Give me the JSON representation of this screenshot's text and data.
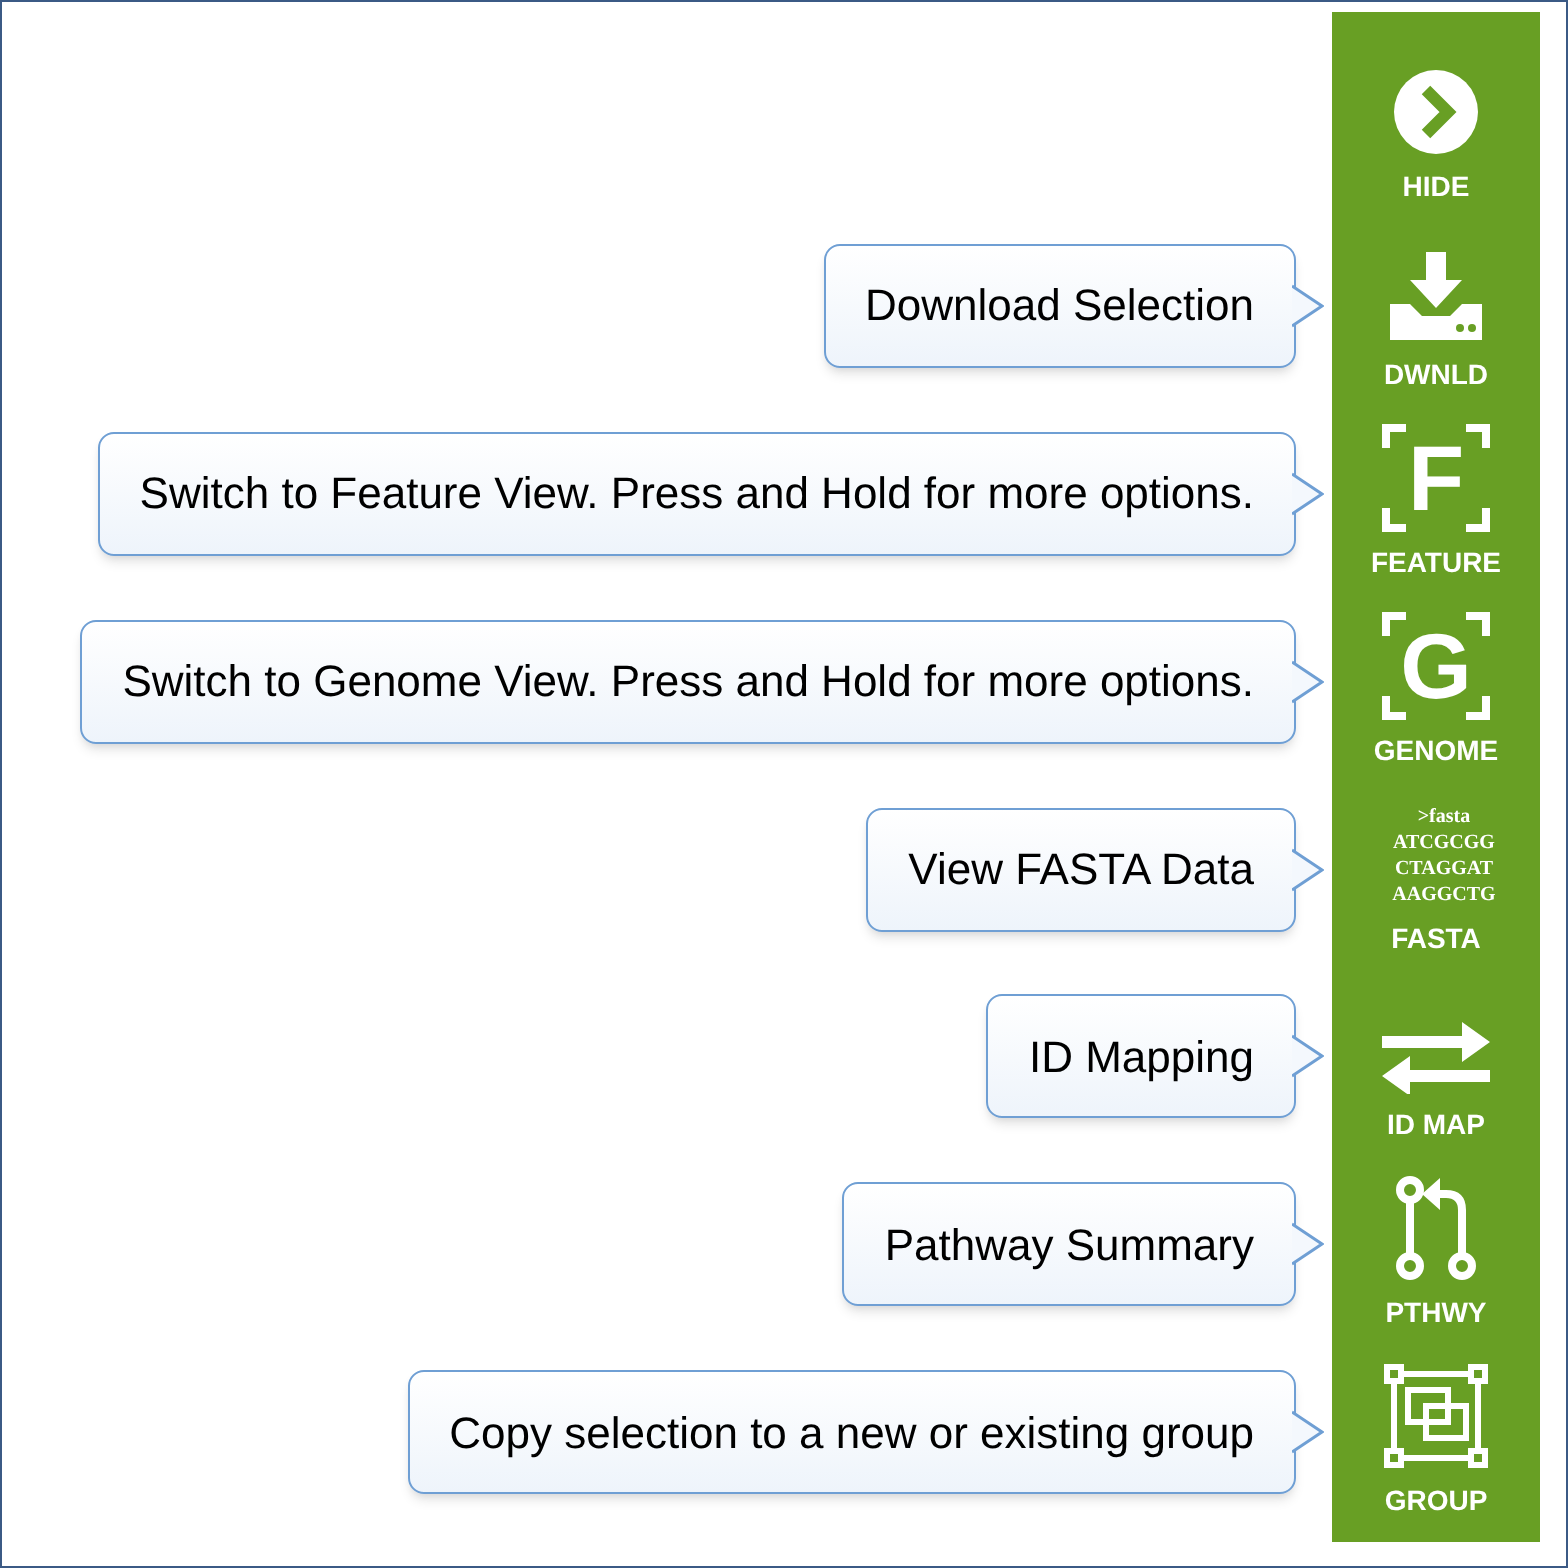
{
  "sidebar": {
    "items": [
      {
        "kind": "hide",
        "label": "HIDE"
      },
      {
        "kind": "download",
        "label": "DWNLD",
        "tooltip": "Download Selection"
      },
      {
        "kind": "feature",
        "label": "FEATURE",
        "icon_letter": "F",
        "tooltip": "Switch to Feature View. Press and Hold for more options."
      },
      {
        "kind": "genome",
        "label": "GENOME",
        "icon_letter": "G",
        "tooltip": "Switch to Genome View. Press and Hold for more options."
      },
      {
        "kind": "fasta",
        "label": "FASTA",
        "icon_lines": [
          ">fasta",
          "ATCGCGG",
          "CTAGGAT",
          "AAGGCTG"
        ],
        "tooltip": "View FASTA Data"
      },
      {
        "kind": "idmap",
        "label": "ID MAP",
        "tooltip": "ID Mapping"
      },
      {
        "kind": "pathway",
        "label": "PTHWY",
        "tooltip": "Pathway Summary"
      },
      {
        "kind": "group",
        "label": "GROUP",
        "tooltip": "Copy selection to a new or existing group"
      }
    ]
  }
}
